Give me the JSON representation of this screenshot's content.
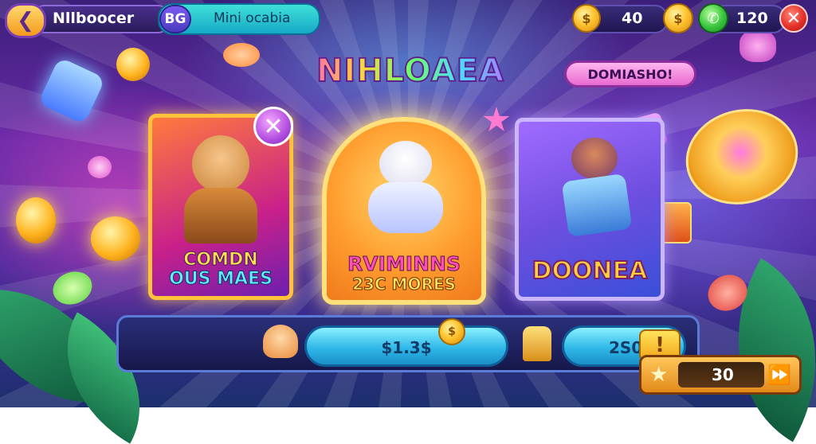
{
  "header": {
    "back_icon": "back-arrow-icon",
    "title": "Nllboocer",
    "badge": "BG",
    "search_text": "Mini ocabia",
    "coins_value": "40",
    "gems_value": "120",
    "close_icon": "close-icon"
  },
  "hero": {
    "title": "NIHLOAEA",
    "promo_label": "DOMIASHO!"
  },
  "cards": [
    {
      "line1": "COMDN",
      "line2": "OUS MAES"
    },
    {
      "line1": "RVIMINNS",
      "line2": "23C MORES"
    },
    {
      "line1": "DOONEA"
    }
  ],
  "bottom": {
    "price": "$1.3$",
    "value": "2S0",
    "exclaim": "!"
  },
  "star_bar": {
    "value": "30"
  },
  "colors": {
    "accent_gold": "#ffc531",
    "accent_cyan": "#2fb8e8",
    "accent_purple": "#6a2aa8",
    "close_red": "#e5312a"
  }
}
